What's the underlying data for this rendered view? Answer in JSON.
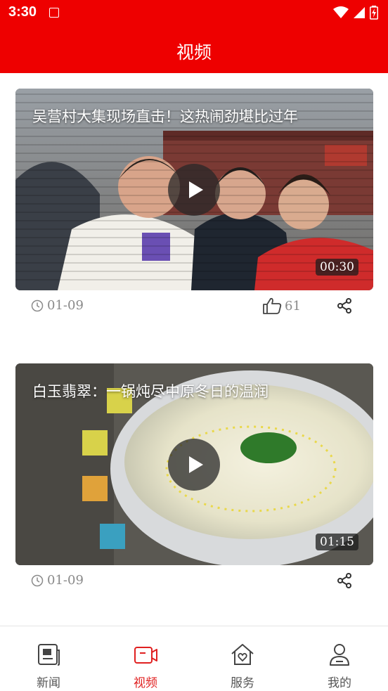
{
  "status_bar": {
    "time": "3:30",
    "colors": {
      "background": "#ee0000",
      "text": "#ffffff"
    }
  },
  "app_bar": {
    "title": "视频"
  },
  "videos": [
    {
      "title": "吴营村大集现场直击！这热闹劲堪比过年",
      "duration": "00:30",
      "date": "01-09",
      "likes": "61"
    },
    {
      "title": "白玉翡翠：一锅炖尽中原冬日的温润",
      "duration": "01:15",
      "date": "01-09"
    }
  ],
  "tabs": [
    {
      "label": "新闻",
      "icon": "news-icon",
      "active": false
    },
    {
      "label": "视频",
      "icon": "video-icon",
      "active": true
    },
    {
      "label": "服务",
      "icon": "home-heart-icon",
      "active": false
    },
    {
      "label": "我的",
      "icon": "user-icon",
      "active": false
    }
  ],
  "colors": {
    "accent": "#ee0000",
    "active_tab": "#e02020",
    "meta_text": "#8a8a8a"
  }
}
